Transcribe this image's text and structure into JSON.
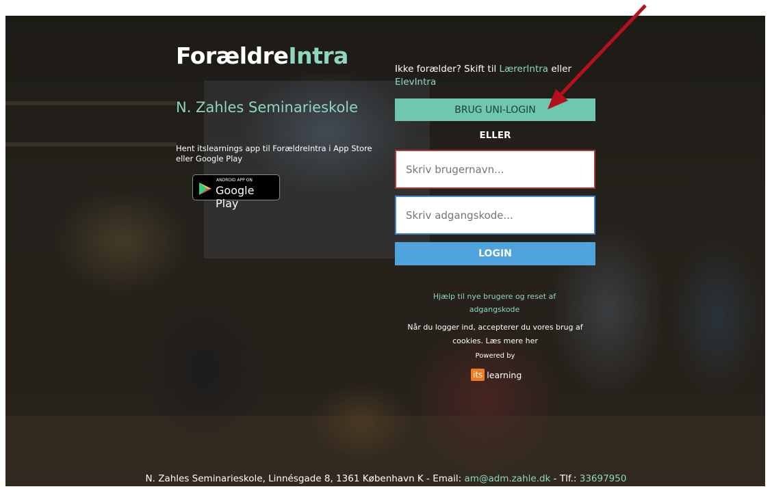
{
  "brand": {
    "main": "Forældre",
    "accent": "Intra"
  },
  "school_name": "N. Zahles Seminarieskole",
  "app_text": "Hent itslearnings app til ForældreIntra i App Store eller Google Play",
  "google_play": {
    "small": "ANDROID APP ON",
    "big": "Google Play"
  },
  "not_parent": {
    "prefix": "Ikke forælder? Skift til ",
    "teacher_link": "LærerIntra",
    "middle": " eller ",
    "student_link": "ElevIntra"
  },
  "unilogin_button": "BRUG UNI-LOGIN",
  "or_label": "ELLER",
  "username_placeholder": "Skriv brugernavn...",
  "password_placeholder": "Skriv adgangskode...",
  "login_button": "LOGIN",
  "help_link": "Hjælp til nye brugere og reset af adgangskode",
  "cookie_text": "Når du logger ind, accepterer du vores brug af cookies. Læs mere her",
  "powered_by": "Powered by",
  "itslearning": {
    "box": "its",
    "word": "learning"
  },
  "footer": {
    "address": "N. Zahles Seminarieskole, Linnésgade 8, 1361 København K - Email: ",
    "email": "am@adm.zahle.dk",
    "phone_label": " - Tlf.: ",
    "phone": "33697950"
  },
  "colors": {
    "accent": "#8fd6c0",
    "unilogin": "#6fc7ad",
    "login": "#4fa3dc",
    "arrow": "#b3121b"
  }
}
